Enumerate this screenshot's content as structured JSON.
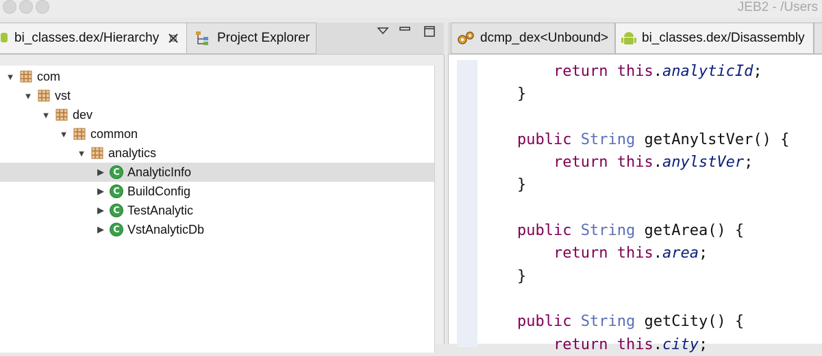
{
  "window": {
    "title": "JEB2 - /Users"
  },
  "left_tabs": [
    {
      "label": "bi_classes.dex/Hierarchy",
      "icon": "android-icon",
      "close_icon": "close-icon"
    },
    {
      "label": "Project Explorer",
      "icon": "project-tree-icon"
    }
  ],
  "left_view_controls": {
    "menu": "view-menu-icon",
    "minimize": "minimize-icon",
    "maximize": "maximize-icon"
  },
  "right_tabs": [
    {
      "label": "dcmp_dex<Unbound>",
      "icon": "gears-icon"
    },
    {
      "label": "bi_classes.dex/Disassembly",
      "icon": "android-icon"
    }
  ],
  "tree": [
    {
      "label": "com",
      "kind": "package",
      "expanded": true
    },
    {
      "label": "vst",
      "kind": "package",
      "expanded": true
    },
    {
      "label": "dev",
      "kind": "package",
      "expanded": true
    },
    {
      "label": "common",
      "kind": "package",
      "expanded": true
    },
    {
      "label": "analytics",
      "kind": "package",
      "expanded": true
    },
    {
      "label": "AnalyticInfo",
      "kind": "class",
      "expanded": false,
      "selected": true
    },
    {
      "label": "BuildConfig",
      "kind": "class",
      "expanded": false
    },
    {
      "label": "TestAnalytic",
      "kind": "class",
      "expanded": false
    },
    {
      "label": "VstAnalyticDb",
      "kind": "class",
      "expanded": false
    }
  ],
  "code": {
    "return_kw": "return",
    "this_kw": "this",
    "public_kw": "public",
    "string_type": "String",
    "field_analyticId": "analyticId",
    "method_getAnylstVer": "getAnylstVer",
    "field_anylstVer": "anylstVer",
    "method_getArea": "getArea",
    "field_area": "area",
    "method_getCity": "getCity",
    "field_city": "city"
  },
  "colors": {
    "keyword": "#7f0055",
    "type": "#5a6fb3",
    "field": "#0b1f7a",
    "class_icon": "#3aa04a",
    "package_icon": "#b5773a"
  }
}
